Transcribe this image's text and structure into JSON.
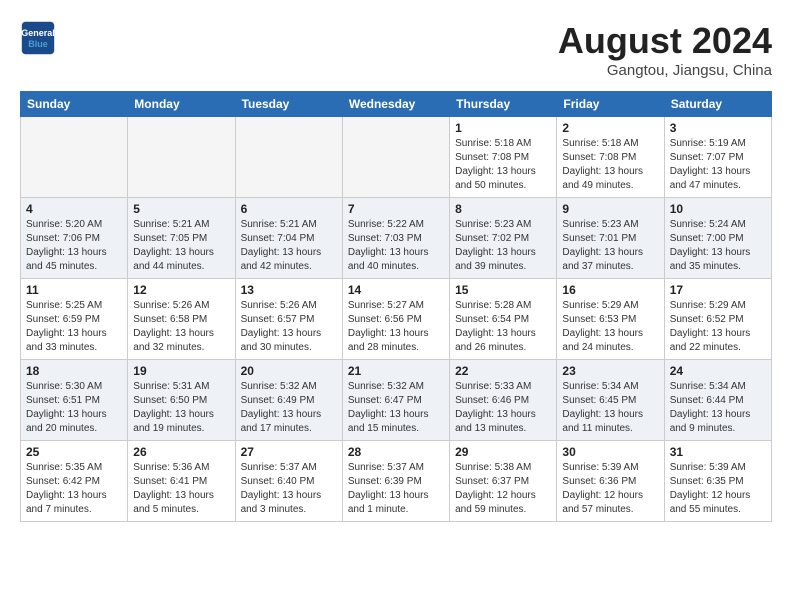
{
  "header": {
    "logo_line1": "General",
    "logo_line2": "Blue",
    "month": "August 2024",
    "location": "Gangtou, Jiangsu, China"
  },
  "weekdays": [
    "Sunday",
    "Monday",
    "Tuesday",
    "Wednesday",
    "Thursday",
    "Friday",
    "Saturday"
  ],
  "weeks": [
    {
      "row_class": "row-even",
      "days": [
        {
          "num": "",
          "info": "",
          "empty": true
        },
        {
          "num": "",
          "info": "",
          "empty": true
        },
        {
          "num": "",
          "info": "",
          "empty": true
        },
        {
          "num": "",
          "info": "",
          "empty": true
        },
        {
          "num": "1",
          "info": "Sunrise: 5:18 AM\nSunset: 7:08 PM\nDaylight: 13 hours\nand 50 minutes."
        },
        {
          "num": "2",
          "info": "Sunrise: 5:18 AM\nSunset: 7:08 PM\nDaylight: 13 hours\nand 49 minutes."
        },
        {
          "num": "3",
          "info": "Sunrise: 5:19 AM\nSunset: 7:07 PM\nDaylight: 13 hours\nand 47 minutes."
        }
      ]
    },
    {
      "row_class": "row-odd",
      "days": [
        {
          "num": "4",
          "info": "Sunrise: 5:20 AM\nSunset: 7:06 PM\nDaylight: 13 hours\nand 45 minutes."
        },
        {
          "num": "5",
          "info": "Sunrise: 5:21 AM\nSunset: 7:05 PM\nDaylight: 13 hours\nand 44 minutes."
        },
        {
          "num": "6",
          "info": "Sunrise: 5:21 AM\nSunset: 7:04 PM\nDaylight: 13 hours\nand 42 minutes."
        },
        {
          "num": "7",
          "info": "Sunrise: 5:22 AM\nSunset: 7:03 PM\nDaylight: 13 hours\nand 40 minutes."
        },
        {
          "num": "8",
          "info": "Sunrise: 5:23 AM\nSunset: 7:02 PM\nDaylight: 13 hours\nand 39 minutes."
        },
        {
          "num": "9",
          "info": "Sunrise: 5:23 AM\nSunset: 7:01 PM\nDaylight: 13 hours\nand 37 minutes."
        },
        {
          "num": "10",
          "info": "Sunrise: 5:24 AM\nSunset: 7:00 PM\nDaylight: 13 hours\nand 35 minutes."
        }
      ]
    },
    {
      "row_class": "row-even",
      "days": [
        {
          "num": "11",
          "info": "Sunrise: 5:25 AM\nSunset: 6:59 PM\nDaylight: 13 hours\nand 33 minutes."
        },
        {
          "num": "12",
          "info": "Sunrise: 5:26 AM\nSunset: 6:58 PM\nDaylight: 13 hours\nand 32 minutes."
        },
        {
          "num": "13",
          "info": "Sunrise: 5:26 AM\nSunset: 6:57 PM\nDaylight: 13 hours\nand 30 minutes."
        },
        {
          "num": "14",
          "info": "Sunrise: 5:27 AM\nSunset: 6:56 PM\nDaylight: 13 hours\nand 28 minutes."
        },
        {
          "num": "15",
          "info": "Sunrise: 5:28 AM\nSunset: 6:54 PM\nDaylight: 13 hours\nand 26 minutes."
        },
        {
          "num": "16",
          "info": "Sunrise: 5:29 AM\nSunset: 6:53 PM\nDaylight: 13 hours\nand 24 minutes."
        },
        {
          "num": "17",
          "info": "Sunrise: 5:29 AM\nSunset: 6:52 PM\nDaylight: 13 hours\nand 22 minutes."
        }
      ]
    },
    {
      "row_class": "row-odd",
      "days": [
        {
          "num": "18",
          "info": "Sunrise: 5:30 AM\nSunset: 6:51 PM\nDaylight: 13 hours\nand 20 minutes."
        },
        {
          "num": "19",
          "info": "Sunrise: 5:31 AM\nSunset: 6:50 PM\nDaylight: 13 hours\nand 19 minutes."
        },
        {
          "num": "20",
          "info": "Sunrise: 5:32 AM\nSunset: 6:49 PM\nDaylight: 13 hours\nand 17 minutes."
        },
        {
          "num": "21",
          "info": "Sunrise: 5:32 AM\nSunset: 6:47 PM\nDaylight: 13 hours\nand 15 minutes."
        },
        {
          "num": "22",
          "info": "Sunrise: 5:33 AM\nSunset: 6:46 PM\nDaylight: 13 hours\nand 13 minutes."
        },
        {
          "num": "23",
          "info": "Sunrise: 5:34 AM\nSunset: 6:45 PM\nDaylight: 13 hours\nand 11 minutes."
        },
        {
          "num": "24",
          "info": "Sunrise: 5:34 AM\nSunset: 6:44 PM\nDaylight: 13 hours\nand 9 minutes."
        }
      ]
    },
    {
      "row_class": "row-even",
      "days": [
        {
          "num": "25",
          "info": "Sunrise: 5:35 AM\nSunset: 6:42 PM\nDaylight: 13 hours\nand 7 minutes."
        },
        {
          "num": "26",
          "info": "Sunrise: 5:36 AM\nSunset: 6:41 PM\nDaylight: 13 hours\nand 5 minutes."
        },
        {
          "num": "27",
          "info": "Sunrise: 5:37 AM\nSunset: 6:40 PM\nDaylight: 13 hours\nand 3 minutes."
        },
        {
          "num": "28",
          "info": "Sunrise: 5:37 AM\nSunset: 6:39 PM\nDaylight: 13 hours\nand 1 minute."
        },
        {
          "num": "29",
          "info": "Sunrise: 5:38 AM\nSunset: 6:37 PM\nDaylight: 12 hours\nand 59 minutes."
        },
        {
          "num": "30",
          "info": "Sunrise: 5:39 AM\nSunset: 6:36 PM\nDaylight: 12 hours\nand 57 minutes."
        },
        {
          "num": "31",
          "info": "Sunrise: 5:39 AM\nSunset: 6:35 PM\nDaylight: 12 hours\nand 55 minutes."
        }
      ]
    }
  ]
}
